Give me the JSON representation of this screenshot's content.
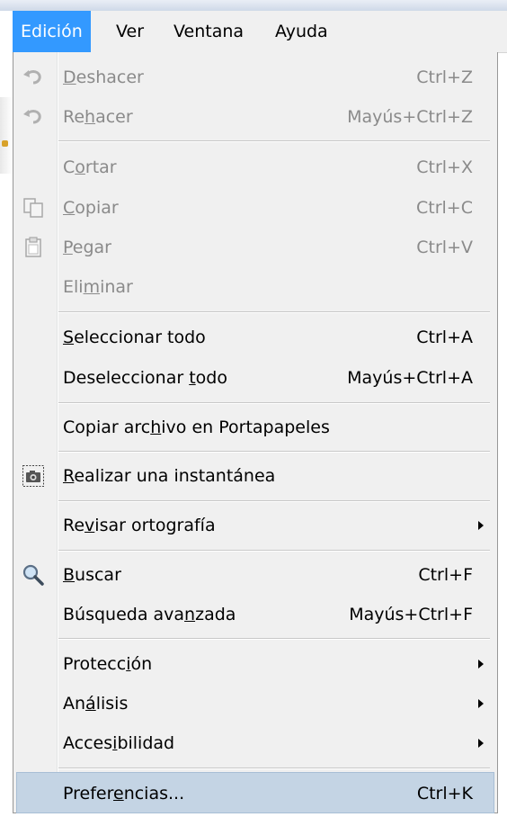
{
  "menubar": {
    "items": [
      {
        "label": "Edición",
        "active": true
      },
      {
        "label": "Ver"
      },
      {
        "label": "Ventana"
      },
      {
        "label": "Ayuda"
      }
    ]
  },
  "menu": {
    "items": [
      {
        "pre": "",
        "acc": "D",
        "post": "eshacer",
        "shortcut": "Ctrl+Z",
        "disabled": true,
        "icon": "undo-icon"
      },
      {
        "pre": "Re",
        "acc": "h",
        "post": "acer",
        "shortcut": "Mayús+Ctrl+Z",
        "disabled": true,
        "icon": "redo-icon"
      },
      {
        "pre": "C",
        "acc": "o",
        "post": "rtar",
        "shortcut": "Ctrl+X",
        "disabled": true
      },
      {
        "pre": "",
        "acc": "C",
        "post": "opiar",
        "shortcut": "Ctrl+C",
        "disabled": true,
        "icon": "copy-icon"
      },
      {
        "pre": "",
        "acc": "P",
        "post": "egar",
        "shortcut": "Ctrl+V",
        "disabled": true,
        "icon": "paste-icon"
      },
      {
        "pre": "Eli",
        "acc": "m",
        "post": "inar",
        "shortcut": "",
        "disabled": true
      },
      {
        "pre": "",
        "acc": "S",
        "post": "eleccionar todo",
        "shortcut": "Ctrl+A"
      },
      {
        "pre": "Deseleccionar ",
        "acc": "t",
        "post": "odo",
        "shortcut": "Mayús+Ctrl+A"
      },
      {
        "pre": "Copiar arc",
        "acc": "h",
        "post": "ivo en Portapapeles",
        "shortcut": ""
      },
      {
        "pre": "",
        "acc": "R",
        "post": "ealizar una instantánea",
        "shortcut": "",
        "icon": "camera-icon"
      },
      {
        "pre": "Re",
        "acc": "v",
        "post": "isar ortografía",
        "shortcut": "",
        "submenu": true
      },
      {
        "pre": "",
        "acc": "B",
        "post": "uscar",
        "shortcut": "Ctrl+F",
        "icon": "search-icon"
      },
      {
        "pre": "Búsqueda ava",
        "acc": "n",
        "post": "zada",
        "shortcut": "Mayús+Ctrl+F"
      },
      {
        "pre": "Protecc",
        "acc": "i",
        "post": "ón",
        "shortcut": "",
        "submenu": true
      },
      {
        "pre": "An",
        "acc": "á",
        "post": "lisis",
        "shortcut": "",
        "submenu": true
      },
      {
        "pre": "Acces",
        "acc": "i",
        "post": "bilidad",
        "shortcut": "",
        "submenu": true
      },
      {
        "pre": "Prefer",
        "acc": "e",
        "post": "ncias...",
        "shortcut": "Ctrl+K",
        "highlighted": true
      }
    ]
  },
  "colors": {
    "menu_bg": "#f0f0f0",
    "highlight": "#c4d4e4",
    "active_menubar": "#3399ff",
    "disabled_text": "#8a8a8a"
  }
}
